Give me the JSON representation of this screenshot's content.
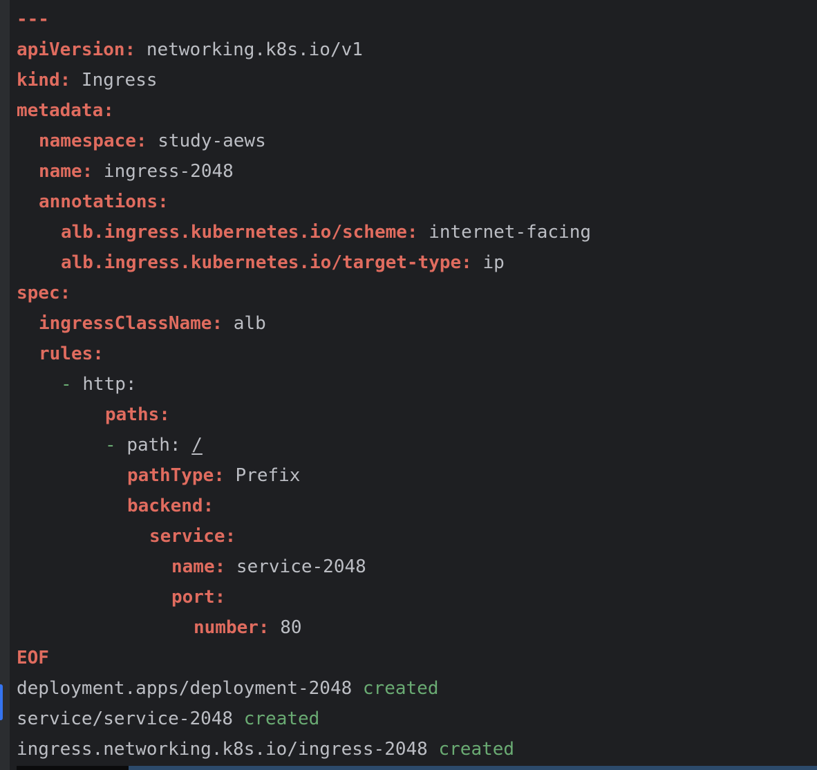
{
  "lines": {
    "l0": {
      "text": "---"
    },
    "l1": {
      "key": "apiVersion:",
      "val": " networking.k8s.io/v1"
    },
    "l2": {
      "key": "kind:",
      "val": " Ingress"
    },
    "l3": {
      "key": "metadata:"
    },
    "l4": {
      "key": "namespace:",
      "val": " study-aews"
    },
    "l5": {
      "key": "name:",
      "val": " ingress-2048"
    },
    "l6": {
      "key": "annotations:"
    },
    "l7": {
      "key": "alb.ingress.kubernetes.io/scheme:",
      "val": " internet-facing"
    },
    "l8": {
      "key": "alb.ingress.kubernetes.io/target-type:",
      "val": " ip"
    },
    "l9": {
      "key": "spec:"
    },
    "l10": {
      "key": "ingressClassName:",
      "val": " alb"
    },
    "l11": {
      "key": "rules:"
    },
    "l12": {
      "dash": "- ",
      "val": "http:"
    },
    "l13": {
      "key": "paths:"
    },
    "l14": {
      "dash": "- ",
      "val": "path: ",
      "under": "/"
    },
    "l15": {
      "key": "pathType:",
      "val": " Prefix"
    },
    "l16": {
      "key": "backend:"
    },
    "l17": {
      "key": "service:"
    },
    "l18": {
      "key": "name:",
      "val": " service-2048"
    },
    "l19": {
      "key": "port:"
    },
    "l20": {
      "key": "number:",
      "val": " 80"
    },
    "l21": {
      "key": "EOF"
    }
  },
  "output": [
    {
      "resource": "deployment.apps/deployment-2048 ",
      "status": "created"
    },
    {
      "resource": "service/service-2048 ",
      "status": "created"
    },
    {
      "resource": "ingress.networking.k8s.io/ingress-2048 ",
      "status": "created"
    }
  ],
  "colors": {
    "background": "#1e1f22",
    "key": "#e06c5f",
    "value": "#bcbec4",
    "created": "#6aab73",
    "change_marker": "#3574f0"
  }
}
